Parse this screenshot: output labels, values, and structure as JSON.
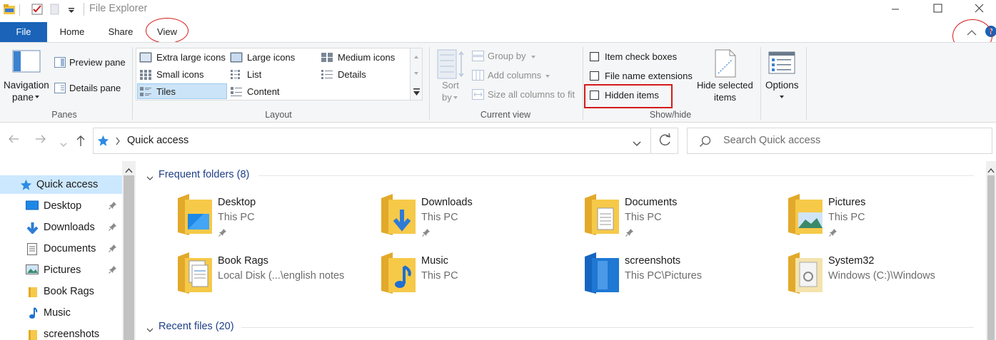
{
  "window": {
    "title": "File Explorer"
  },
  "tabs": {
    "file": "File",
    "home": "Home",
    "share": "Share",
    "view": "View"
  },
  "ribbon": {
    "panes": {
      "navigation_pane_line1": "Navigation",
      "navigation_pane_line2": "pane",
      "preview_pane": "Preview pane",
      "details_pane": "Details pane",
      "group_label": "Panes"
    },
    "layout": {
      "extra_large_icons": "Extra large icons",
      "large_icons": "Large icons",
      "medium_icons": "Medium icons",
      "small_icons": "Small icons",
      "list": "List",
      "details": "Details",
      "tiles": "Tiles",
      "content": "Content",
      "selected": "Tiles",
      "group_label": "Layout"
    },
    "current_view": {
      "sort_by_line1": "Sort",
      "sort_by_line2": "by",
      "group_by": "Group by",
      "add_columns": "Add columns",
      "size_all_columns": "Size all columns to fit",
      "group_label": "Current view"
    },
    "show_hide": {
      "item_check_boxes": "Item check boxes",
      "file_name_extensions": "File name extensions",
      "hidden_items": "Hidden items",
      "hide_selected_line1": "Hide selected",
      "hide_selected_line2": "items",
      "group_label": "Show/hide"
    },
    "options": {
      "label": "Options"
    }
  },
  "address": {
    "path": "Quick access",
    "search_placeholder": "Search Quick access"
  },
  "nav_pane": {
    "items": [
      {
        "label": "Quick access",
        "icon": "star-icon",
        "pinned": false,
        "selected": true
      },
      {
        "label": "Desktop",
        "icon": "desktop-icon",
        "pinned": true
      },
      {
        "label": "Downloads",
        "icon": "download-arrow-icon",
        "pinned": true
      },
      {
        "label": "Documents",
        "icon": "document-icon",
        "pinned": true
      },
      {
        "label": "Pictures",
        "icon": "pictures-icon",
        "pinned": true
      },
      {
        "label": "Book Rags",
        "icon": "folder-icon",
        "pinned": false
      },
      {
        "label": "Music",
        "icon": "music-note-icon",
        "pinned": false
      },
      {
        "label": "screenshots",
        "icon": "folder-icon",
        "pinned": false
      }
    ]
  },
  "content": {
    "frequent_title": "Frequent folders (8)",
    "recent_title": "Recent files (20)",
    "folders": [
      {
        "name": "Desktop",
        "location": "This PC",
        "pinned": true,
        "icon": "desktop-folder-icon"
      },
      {
        "name": "Downloads",
        "location": "This PC",
        "pinned": true,
        "icon": "downloads-folder-icon"
      },
      {
        "name": "Documents",
        "location": "This PC",
        "pinned": true,
        "icon": "documents-folder-icon"
      },
      {
        "name": "Pictures",
        "location": "This PC",
        "pinned": true,
        "icon": "pictures-folder-icon"
      },
      {
        "name": "Book Rags",
        "location": "Local Disk (...\\english notes",
        "pinned": false,
        "icon": "folder-with-files-icon"
      },
      {
        "name": "Music",
        "location": "This PC",
        "pinned": false,
        "icon": "music-folder-icon"
      },
      {
        "name": "screenshots",
        "location": "This PC\\Pictures",
        "pinned": false,
        "icon": "blue-folder-icon"
      },
      {
        "name": "System32",
        "location": "Windows (C:)\\Windows",
        "pinned": false,
        "icon": "system-folder-icon"
      }
    ]
  },
  "colors": {
    "accent": "#1a63b8",
    "selection": "#cce8ff",
    "annotation_red": "#d31b1b",
    "section_title": "#1e3f87"
  }
}
